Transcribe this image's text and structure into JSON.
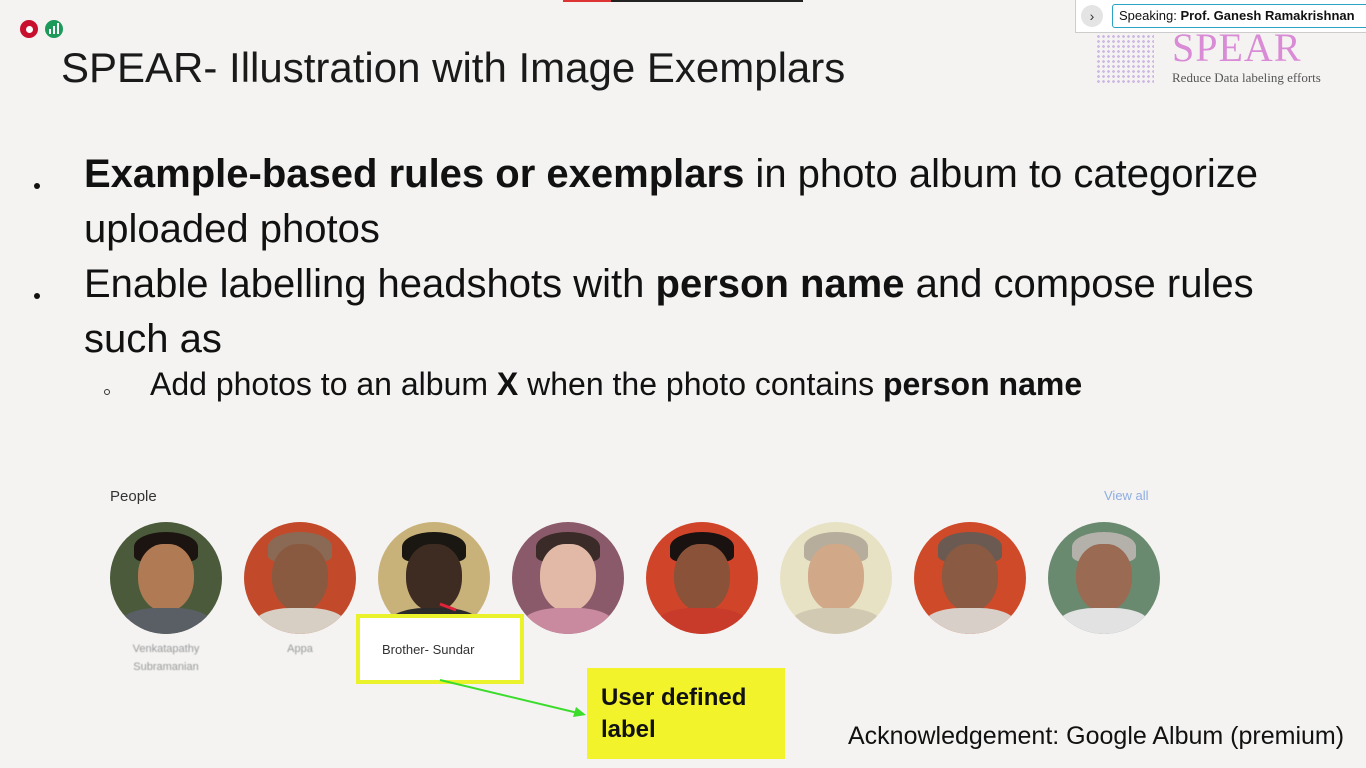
{
  "meeting": {
    "speaking_label": "Speaking:",
    "speaker_name": "Prof. Ganesh Ramakrishnan"
  },
  "logo": {
    "title": "SPEAR",
    "subtitle": "Reduce Data labeling efforts"
  },
  "slide": {
    "title": "SPEAR- Illustration with Image Exemplars",
    "bullet1": {
      "bold": "Example-based rules or exemplars",
      "rest": " in photo album to categorize uploaded photos"
    },
    "bullet2": {
      "pre": "Enable labelling headshots with ",
      "bold": "person name",
      "rest": " and compose rules such as"
    },
    "sub_bullet": {
      "pre": "Add photos to an album ",
      "bold_x": "X",
      "mid": " when the photo contains ",
      "bold_end": "person name"
    },
    "people_heading": "People",
    "view_all": "View all",
    "captions": [
      "Venkatapathy Subramanian",
      "Appa"
    ],
    "user_label": "Brother- Sundar",
    "callout": "User defined label",
    "acknowledgement": "Acknowledgement: Google Album (premium)"
  },
  "colors": {
    "highlight_yellow": "#e9f22a",
    "arrow_green": "#3cdc2c",
    "speaking_border": "#2aa3c7",
    "logo_pink": "#d98bd6"
  }
}
